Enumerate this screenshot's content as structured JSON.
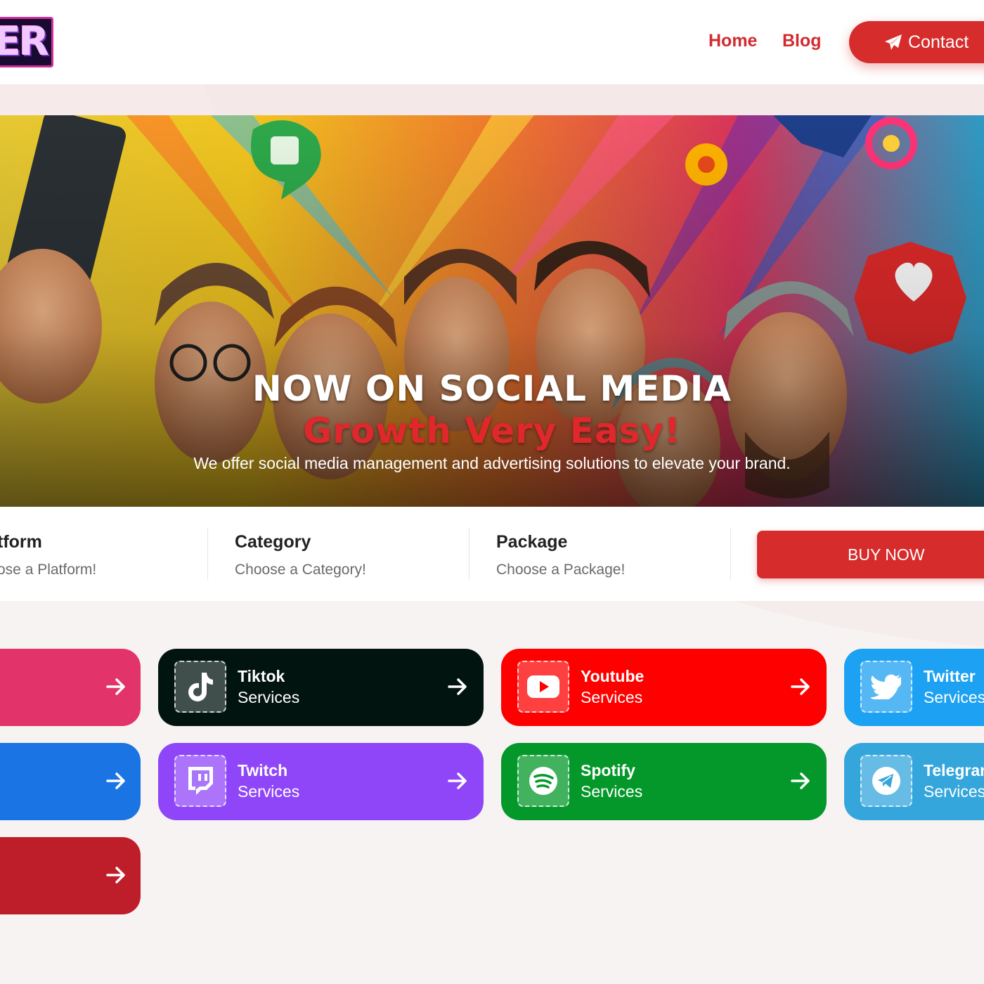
{
  "header": {
    "logo_text": "ER",
    "nav": {
      "home": "Home",
      "blog": "Blog",
      "contact": "Contact"
    }
  },
  "hero": {
    "title": "NOW ON SOCIAL MEDIA",
    "subtitle": "Growth Very Easy!",
    "description": "We offer social media management and advertising solutions to elevate your brand."
  },
  "selector": {
    "platform": {
      "label": "tform",
      "hint": "ose a Platform!"
    },
    "category": {
      "label": "Category",
      "hint": "Choose a Category!"
    },
    "package": {
      "label": "Package",
      "hint": "Choose a Package!"
    },
    "buy_label": "BUY NOW"
  },
  "services": {
    "partial_1": {
      "color": "#e2336b",
      "icon": "arrow-right-icon"
    },
    "tiktok": {
      "name": "Tiktok",
      "sub": "Services",
      "color": "#021410",
      "icon": "tiktok-icon"
    },
    "youtube": {
      "name": "Youtube",
      "sub": "Services",
      "color": "#fe0000",
      "icon": "youtube-icon"
    },
    "twitter": {
      "name": "Twitter",
      "sub": "Services",
      "color": "#1da1f2",
      "icon": "twitter-icon"
    },
    "partial_2": {
      "color": "#1b74e4",
      "icon": "arrow-right-icon"
    },
    "twitch": {
      "name": "Twitch",
      "sub": "Services",
      "color": "#8f46f8",
      "icon": "twitch-icon"
    },
    "spotify": {
      "name": "Spotify",
      "sub": "Services",
      "color": "#04982a",
      "icon": "spotify-icon"
    },
    "telegram": {
      "name": "Telegram",
      "sub": "Services",
      "color": "#35a6dc",
      "icon": "telegram-icon"
    },
    "partial_3": {
      "color": "#be1d2a",
      "icon": "arrow-right-icon"
    }
  },
  "colors": {
    "accent": "#d62c2c",
    "background": "#f8f3f3"
  }
}
